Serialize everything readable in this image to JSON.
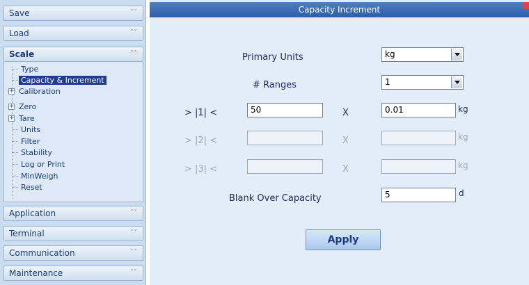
{
  "sidebar": {
    "sections": {
      "save": "Save",
      "load": "Load",
      "scale": "Scale",
      "application": "Application",
      "terminal": "Terminal",
      "communication": "Communication",
      "maintenance": "Maintenance"
    },
    "collapse_glyph": "»",
    "scale_items": {
      "type": "Type",
      "capacity": "Capacity & Increment",
      "calibration": "Calibration",
      "zero": "Zero",
      "tare": "Tare",
      "units": "Units",
      "filter": "Filter",
      "stability": "Stability",
      "log_print": "Log or Print",
      "minweigh": "MinWeigh",
      "reset": "Reset"
    },
    "expander": "+"
  },
  "panel": {
    "title": "Capacity  Increment",
    "primary_units_label": "Primary Units",
    "primary_units_value": "kg",
    "ranges_label": "# Ranges",
    "ranges_value": "1",
    "range1_label": "> |1| <",
    "range2_label": "> |2| <",
    "range3_label": "> |3| <",
    "range1_capacity": "50",
    "range1_increment": "0.01",
    "times": "X",
    "unit_kg": "kg",
    "blank_over_label": "Blank Over Capacity",
    "blank_over_value": "5",
    "blank_over_unit": "d",
    "apply_label": "Apply"
  },
  "colors": {
    "title_bar": "#2c5ea9",
    "sidebar_bg": "#c9dcf0",
    "selected_item": "#1f3d8f"
  }
}
